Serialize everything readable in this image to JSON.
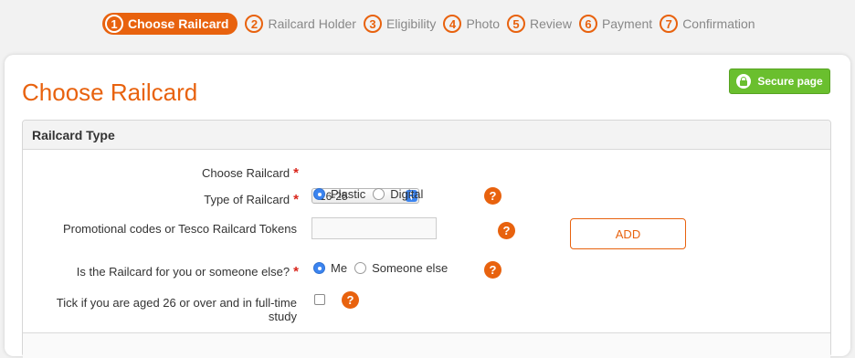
{
  "stepper": {
    "steps": [
      {
        "num": "1",
        "label": "Choose Railcard"
      },
      {
        "num": "2",
        "label": "Railcard Holder"
      },
      {
        "num": "3",
        "label": "Eligibility"
      },
      {
        "num": "4",
        "label": "Photo"
      },
      {
        "num": "5",
        "label": "Review"
      },
      {
        "num": "6",
        "label": "Payment"
      },
      {
        "num": "7",
        "label": "Confirmation"
      }
    ]
  },
  "page": {
    "title": "Choose Railcard",
    "secure_label": "Secure page"
  },
  "panel": {
    "title": "Railcard Type",
    "railcard": {
      "label": "Choose Railcard",
      "required": "*",
      "value": "16-25"
    },
    "type": {
      "label": "Type of Railcard",
      "required": "*",
      "options": [
        "Plastic",
        "Digital"
      ],
      "selected": "Plastic",
      "help": "?"
    },
    "promo": {
      "label": "Promotional codes or Tesco Railcard Tokens",
      "value": "",
      "help": "?",
      "add_label": "ADD"
    },
    "for_whom": {
      "label": "Is the Railcard for you or someone else?",
      "required": "*",
      "options": [
        "Me",
        "Someone else"
      ],
      "selected": "Me",
      "help": "?"
    },
    "student": {
      "label_line1": "Tick if you are aged 26 or over and in full-time",
      "label_line2": "study",
      "checked": false,
      "help": "?"
    }
  },
  "colors": {
    "accent": "#e8620e",
    "secure": "#6abf2e",
    "radio": "#3b84f0"
  }
}
